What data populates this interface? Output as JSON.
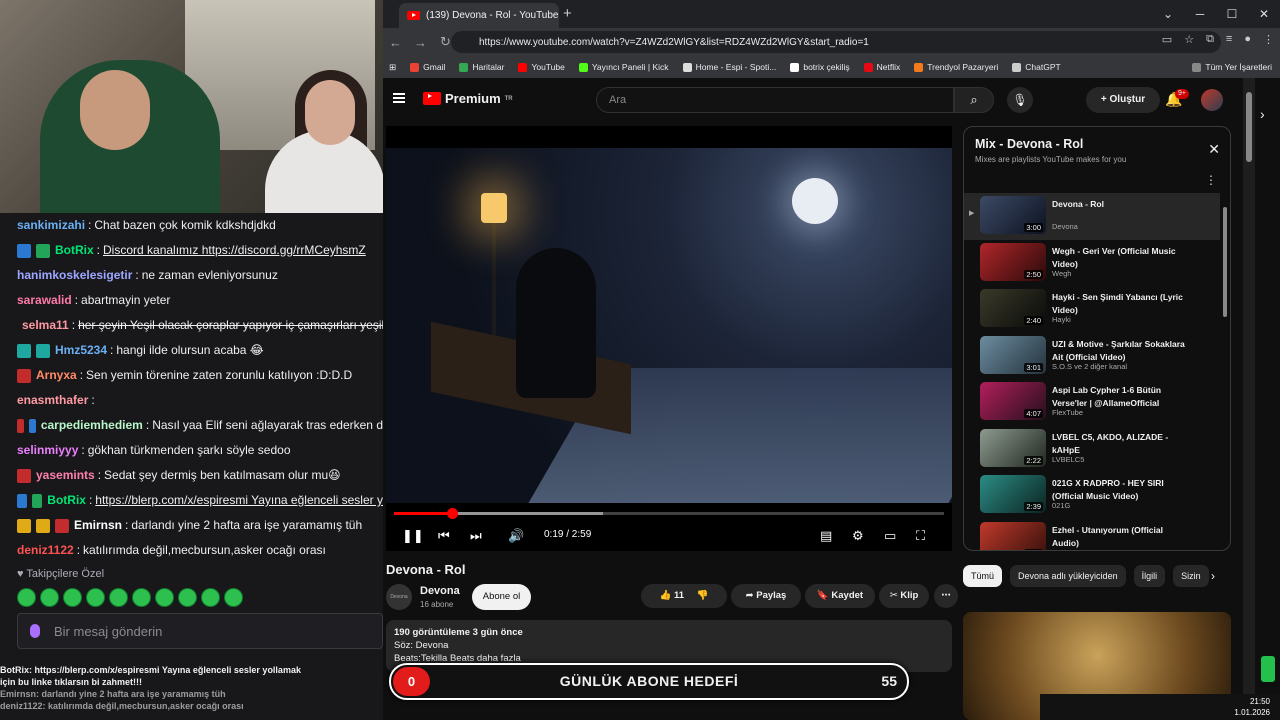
{
  "chat": {
    "messages": [
      {
        "user": "sankimizahi",
        "color": "#6ab0f3",
        "badges": [],
        "text": "Chat bazen çok komik kdkshdjdkd"
      },
      {
        "user": "BotRix",
        "color": "#00e676",
        "badges": [
          "blue",
          "green"
        ],
        "text": "Discord kanalımız https://discord.gg/rrMCeyhsmZ",
        "link": true
      },
      {
        "user": "hanimkoskelesigetir",
        "color": "#9ea7ff",
        "badges": [],
        "text": "ne zaman evleniyorsunuz"
      },
      {
        "user": "sarawalid",
        "color": "#ff7aa8",
        "badges": [],
        "text": "abartmayin yeter"
      },
      {
        "user": "selma11",
        "color": "#ff9aa2",
        "badges": [
          "red"
        ],
        "text": "her şeyin Yeşil olacak çoraplar yapıyor iç çamaşırları yeşil",
        "strike": true
      },
      {
        "user": "Hmz5234",
        "color": "#6ab0f3",
        "badges": [
          "teal",
          "teal"
        ],
        "text": "hangi ilde olursun acaba 😂"
      },
      {
        "user": "Arnyxa",
        "color": "#ff8a65",
        "badges": [
          "red"
        ],
        "text": "Sen yemin törenine zaten zorunlu katılıyon :D:D.D"
      },
      {
        "user": "enasmthafer",
        "color": "#ff9aa2",
        "badges": [],
        "text": ""
      },
      {
        "user": "carpediemhediem",
        "color": "#b9f6ca",
        "badges": [
          "red",
          "purple"
        ],
        "text": "Nasıl yaa Elif seni ağlayarak tras ederken d"
      },
      {
        "user": "selinmiyyy",
        "color": "#ea80fc",
        "badges": [],
        "text": "gökhan türkmenden şarkı söyle sedoo"
      },
      {
        "user": "yasemints",
        "color": "#ff80ab",
        "badges": [
          "red"
        ],
        "text": "Sedat şey dermiş ben katılmasam olur mu😆"
      },
      {
        "user": "BotRix",
        "color": "#00e676",
        "badges": [
          "blue",
          "green"
        ],
        "text": "https://blerp.com/x/espiresmi Yayına eğlenceli sesler y",
        "link": true
      },
      {
        "user": "Emirnsn",
        "color": "#ffffff",
        "badges": [
          "gold",
          "gold",
          "red"
        ],
        "text": "darlandı yine 2 hafta ara işe yaramamış tüh"
      },
      {
        "user": "deniz1122",
        "color": "#ff5252",
        "badges": [],
        "text": "katılırımda değil,mecbursun,asker ocağı orası"
      }
    ],
    "followers_label": "Takipçilere Özel",
    "input_placeholder": "Bir mesaj gönderin",
    "ticker_line1": "BotRix: https://blerp.com/x/espiresmi Yayına eğlenceli sesler yollamak",
    "ticker_line2": "için bu linke tıklarsın bi zahmet!!!",
    "ticker_line3": "Emirnsn: darlandı yine 2 hafta ara işe yaramamış tüh",
    "ticker_line4": "deniz1122: katılırımda değil,mecbursun,asker ocağı orası"
  },
  "browser": {
    "tab_title": "(139) Devona - Rol - YouTube",
    "url": "https://www.youtube.com/watch?v=Z4WZd2WlGY&list=RDZ4WZd2WlGY&start_radio=1",
    "bookmarks": [
      {
        "label": "Gmail",
        "color": "#ea4335"
      },
      {
        "label": "Haritalar",
        "color": "#34a853"
      },
      {
        "label": "YouTube",
        "color": "#ff0000"
      },
      {
        "label": "Yayıncı Paneli | Kick",
        "color": "#53fc18"
      },
      {
        "label": "Home - Espi - Spoti...",
        "color": "#dddddd"
      },
      {
        "label": "botrix çekiliş",
        "color": "#ffffff"
      },
      {
        "label": "Netflix",
        "color": "#e50914"
      },
      {
        "label": "Trendyol Pazaryeri",
        "color": "#f27a1a"
      },
      {
        "label": "ChatGPT",
        "color": "#cccccc"
      }
    ],
    "all_bookmarks": "Tüm Yer İşaretleri"
  },
  "youtube": {
    "brand": "Premium",
    "brand_sup": "TR",
    "search_placeholder": "Ara",
    "create_label": "Oluştur",
    "notif_count": "9+",
    "player": {
      "current": "0:19",
      "total": "2:59",
      "time_display": "0:19 / 2:59",
      "played_fraction": 0.106,
      "buffered_fraction": 0.38
    },
    "video_title": "Devona - Rol",
    "channel": "Devona",
    "subscribers": "16 abone",
    "subscribe_label": "Abone ol",
    "likes": "11",
    "share_label": "Paylaş",
    "save_label": "Kaydet",
    "clip_label": "Klip",
    "desc_stats": "190 görüntüleme  3 gün önce",
    "desc_line1": "Söz: Devona",
    "desc_line2": "Beats:Tekilla Beats     daha fazla",
    "mix": {
      "title": "Mix - Devona - Rol",
      "subtitle": "Mixes are playlists YouTube makes for you",
      "items": [
        {
          "title": "Devona - Rol",
          "artist": "Devona",
          "duration": "3:00",
          "colors": [
            "#3c4a66",
            "#0d1220"
          ]
        },
        {
          "title": "Wegh - Geri Ver (Official Music Video)",
          "artist": "Wegh",
          "duration": "2:50",
          "colors": [
            "#b0262a",
            "#2a0a0a"
          ]
        },
        {
          "title": "Hayki - Sen Şimdi Yabancı (Lyric Video)",
          "artist": "Hayki",
          "duration": "2:40",
          "colors": [
            "#3a3a2a",
            "#0a0a0a"
          ]
        },
        {
          "title": "UZI & Motive - Şarkılar Sokaklara Ait (Official Video)",
          "artist": "S.O.S ve 2 diğer kanal",
          "duration": "3:01",
          "colors": [
            "#6b8da0",
            "#25323c"
          ]
        },
        {
          "title": "Aspi Lab Cypher 1-6 Bütün Verse'ler | @AllameOfficial",
          "artist": "FlexTube",
          "duration": "4:07",
          "colors": [
            "#b31e5a",
            "#24101e"
          ]
        },
        {
          "title": "LVBEL C5, AKDO, ALIZADE - kAHpE",
          "artist": "LVBELC5",
          "duration": "2:22",
          "colors": [
            "#8e9a8f",
            "#202820"
          ]
        },
        {
          "title": "021G X RADPRO - HEY SIRI (Official Music Video)",
          "artist": "021G",
          "duration": "2:39",
          "colors": [
            "#2c8c86",
            "#0b2420"
          ]
        },
        {
          "title": "Ezhel - Utanıyorum (Official Audio)",
          "artist": "",
          "duration": "2:59",
          "colors": [
            "#c0392b",
            "#30100a"
          ]
        }
      ]
    },
    "chips": [
      "Tümü",
      "Devona adlı yükleyiciden",
      "İlgili",
      "Sizin"
    ]
  },
  "goal": {
    "count": "0",
    "label": "GÜNLÜK ABONE HEDEFİ",
    "target": "55"
  },
  "clock": {
    "time": "21:50",
    "date": "1.01.2026"
  }
}
